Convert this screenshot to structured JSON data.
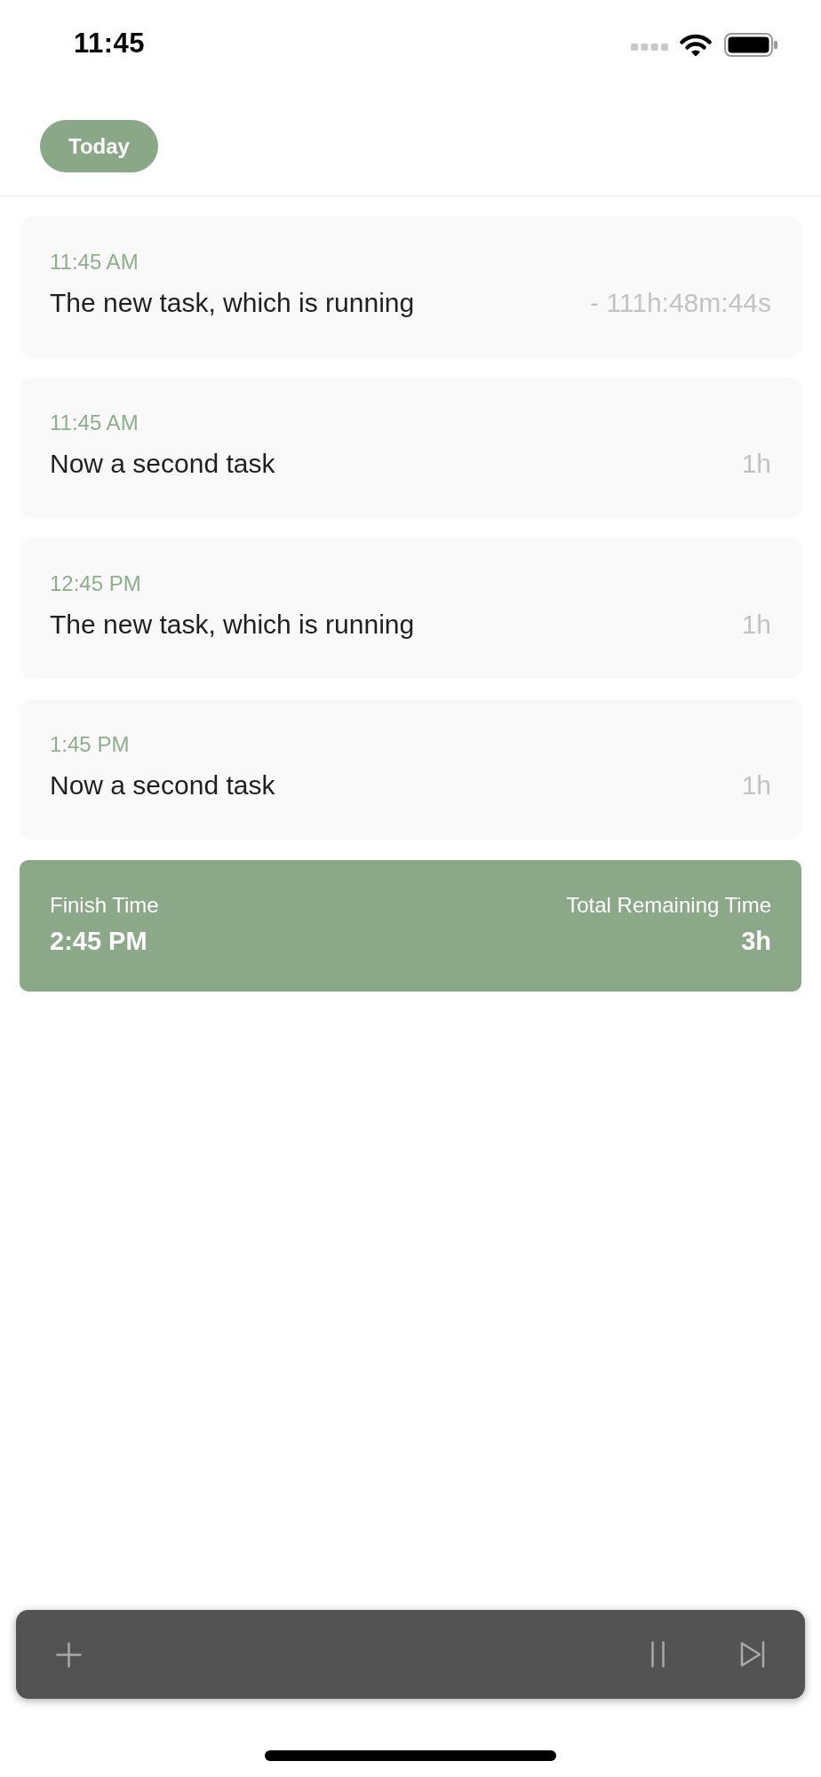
{
  "status_bar": {
    "time": "11:45"
  },
  "header": {
    "date_filter": {
      "label": "Today"
    }
  },
  "tasks": [
    {
      "start_time": "11:45 AM",
      "title": "The new task, which is running",
      "duration": "- 111h:48m:44s"
    },
    {
      "start_time": "11:45 AM",
      "title": "Now a second task",
      "duration": "1h"
    },
    {
      "start_time": "12:45 PM",
      "title": "The new task, which is running",
      "duration": "1h"
    },
    {
      "start_time": "1:45 PM",
      "title": "Now a second task",
      "duration": "1h"
    }
  ],
  "summary": {
    "finish_label": "Finish Time",
    "finish_time": "2:45 PM",
    "remaining_label": "Total Remaining Time",
    "remaining_time": "3h"
  }
}
